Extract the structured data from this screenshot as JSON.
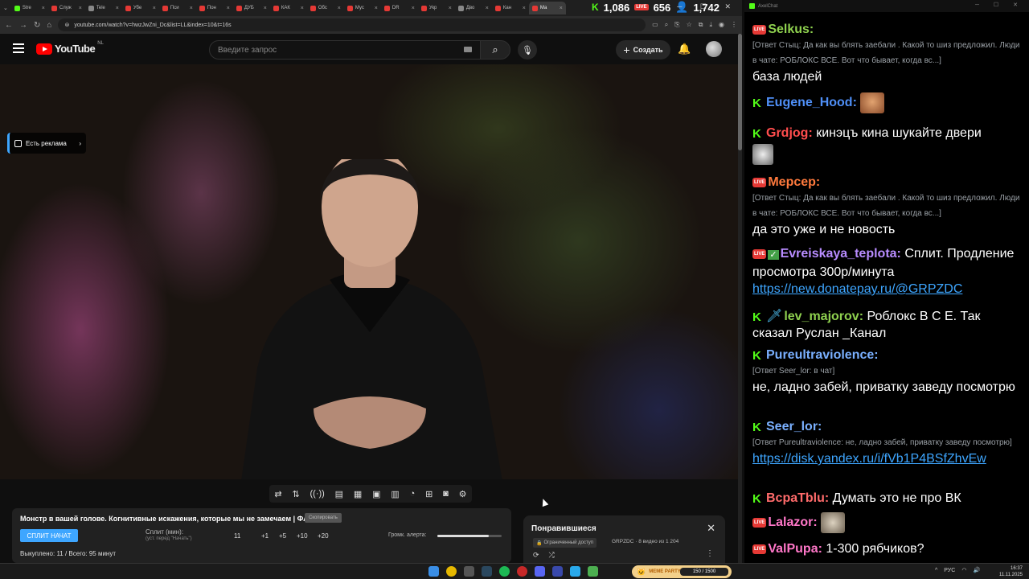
{
  "browser": {
    "tabs": [
      {
        "label": "Stre",
        "color": "#53fc18"
      },
      {
        "label": "Служ",
        "color": "#e53935"
      },
      {
        "label": "Tele",
        "color": "#888888"
      },
      {
        "label": "Убе",
        "color": "#e53935"
      },
      {
        "label": "Пси",
        "color": "#e53935"
      },
      {
        "label": "Пон",
        "color": "#e53935"
      },
      {
        "label": "ДУБ",
        "color": "#e53935"
      },
      {
        "label": "КАК",
        "color": "#e53935"
      },
      {
        "label": "Обс",
        "color": "#e53935"
      },
      {
        "label": "Мус",
        "color": "#e53935"
      },
      {
        "label": "DR",
        "color": "#e53935"
      },
      {
        "label": "Укр",
        "color": "#e53935"
      },
      {
        "label": "Дво",
        "color": "#888888"
      },
      {
        "label": "Кан",
        "color": "#e53935"
      },
      {
        "label": "Ма",
        "color": "#e53935"
      }
    ],
    "url": "youtube.com/watch?v=hwzJwZni_Dc&list=LL&index=10&t=16s",
    "stats": {
      "kick_viewers": "1,086",
      "yt_viewers": "656",
      "followers": "1,742"
    }
  },
  "youtube": {
    "logo_text": "YouTube",
    "region": "NL",
    "search_placeholder": "Введите запрос",
    "create_label": "Создать",
    "ad_chip": "Есть реклама"
  },
  "split_panel": {
    "title": "Монстр в вашей голове. Когнитивные искажения, которые мы не замечаем | ФАЙБ",
    "badge": "Скопировать",
    "start_button": "СПЛИТ НАЧАТ",
    "split_label": "Сплит (мин):",
    "split_hint": "(уст. перед \"Начать\")",
    "value": "11",
    "increments": [
      "+1",
      "+5",
      "+10",
      "+20"
    ],
    "alert_label": "Громк. алерта:",
    "alert_volume": 0.8,
    "bought": "Выкуплено: 11 / Всего: 95 минут"
  },
  "playlist": {
    "title": "Понравившиеся",
    "access": "Ограниченный доступ",
    "owner": "GRPZDC · 8 видео из 1 204"
  },
  "chat": {
    "title": "AxelChat",
    "messages": [
      {
        "user": "Selkus:",
        "badge": "live",
        "color": "#8fd14f",
        "reply": "[Ответ Стыц: Да как вы блять заебали . Какой то шиз предложил. Люди в чате: РОБЛОКС ВСЕ. Вот что бывает, когда вс...]",
        "text": "база людей"
      },
      {
        "user": "Eugene_Hood:",
        "badge": "kick",
        "color": "#4f8ff7",
        "text": ""
      },
      {
        "user": "Grdjog:",
        "badge": "kick",
        "color": "#ff4d4d",
        "text": "кинэцъ кина шукайте двери"
      },
      {
        "user": "Мерсер:",
        "badge": "live",
        "color": "#ff7a3d",
        "reply": "[Ответ Стыц: Да как вы блять заебали . Какой то шиз предложил. Люди в чате: РОБЛОКС ВСЕ. Вот что бывает, когда вс...]",
        "text": "да это уже и не новость"
      },
      {
        "user": "Evreiskaya_teplota:",
        "badge": "live",
        "color": "#b88cff",
        "text": "Сплит. Продление просмотра 300р/минута",
        "link": "https://new.donatepay.ru/@GRPZDC"
      },
      {
        "user": "lev_majorov:",
        "badge": "kick",
        "color": "#8fd14f",
        "text": "Роблокс В С Е. Так сказал Руслан _Канал"
      },
      {
        "user": "Pureultraviolence:",
        "badge": "kick",
        "color": "#7ab0ff",
        "reply": "[Ответ Seer_lor: в чат]",
        "text": "не, ладно забей, приватку заведу посмотрю"
      },
      {
        "user": "Seer_lor:",
        "badge": "kick",
        "color": "#7ab0ff",
        "reply": "[Ответ Pureultraviolence: не, ладно забей, приватку заведу посмотрю]",
        "link": "https://disk.yandex.ru/i/fVb1P4BSfZhvEw"
      },
      {
        "user": "BcpaTblu:",
        "badge": "kick",
        "color": "#ff6b6b",
        "text": "Думать это не про ВК"
      },
      {
        "user": "Lalazor:",
        "badge": "live",
        "color": "#ff77c8",
        "text": ""
      },
      {
        "user": "ValPupa:",
        "badge": "live",
        "color": "#ff77c8",
        "text": "1-300 рябчиков?"
      }
    ]
  },
  "taskbar": {
    "meme_label": "MEME PARTY",
    "meme_progress": "150 / 1500",
    "lang": "РУС",
    "time": "16:37",
    "date": "11.11.2025"
  }
}
